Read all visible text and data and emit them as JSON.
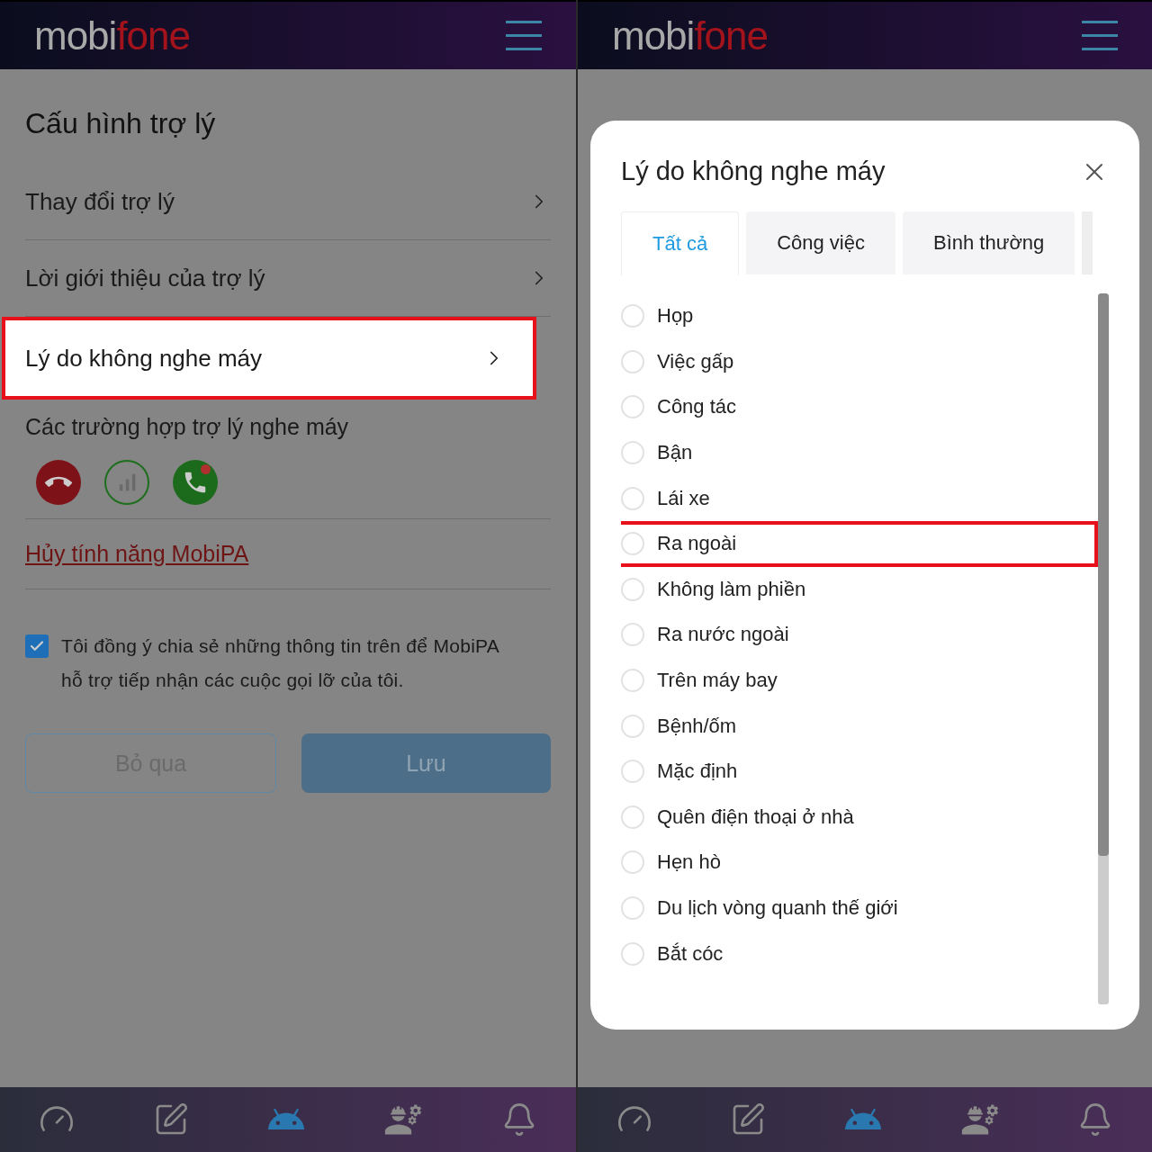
{
  "left_screen": {
    "logo": [
      "mobi",
      "fone"
    ],
    "title": "Cấu hình trợ lý",
    "menu": [
      {
        "label": "Thay đổi trợ lý",
        "highlighted": false
      },
      {
        "label": "Lời giới thiệu của trợ lý",
        "highlighted": false
      },
      {
        "label": "Lý do không nghe máy",
        "highlighted": true
      }
    ],
    "cases_label": "Các trường hợp trợ lý nghe máy",
    "cancel_link": "Hủy tính năng MobiPA",
    "consent": {
      "text": "Tôi đồng ý chia sẻ những thông tin trên để MobiPA hỗ trợ tiếp nhận các cuộc gọi lỡ của tôi.",
      "checked": true
    },
    "buttons": [
      {
        "label": "Bỏ qua",
        "kind": "outline"
      },
      {
        "label": "Lưu",
        "kind": "primary"
      }
    ],
    "nav": [
      {
        "kind": "gauge",
        "selected": false
      },
      {
        "kind": "edit",
        "selected": false
      },
      {
        "kind": "android",
        "selected": true
      },
      {
        "kind": "engineer",
        "selected": false
      },
      {
        "kind": "bell",
        "selected": false
      }
    ]
  },
  "right_screen": {
    "logo": [
      "mobi",
      "fone"
    ],
    "modal": {
      "title": "Lý do không nghe máy",
      "tabs": [
        {
          "label": "Tất cả",
          "selected": true
        },
        {
          "label": "Công việc",
          "selected": false
        },
        {
          "label": "Bình thường",
          "selected": false
        }
      ],
      "reasons": [
        {
          "label": "Họp",
          "selected": false,
          "highlighted": false
        },
        {
          "label": "Việc gấp",
          "selected": false,
          "highlighted": false
        },
        {
          "label": "Công tác",
          "selected": false,
          "highlighted": false
        },
        {
          "label": "Bận",
          "selected": false,
          "highlighted": false
        },
        {
          "label": "Lái xe",
          "selected": false,
          "highlighted": false
        },
        {
          "label": "Ra ngoài",
          "selected": false,
          "highlighted": true
        },
        {
          "label": "Không làm phiền",
          "selected": false,
          "highlighted": false
        },
        {
          "label": "Ra nước ngoài",
          "selected": false,
          "highlighted": false
        },
        {
          "label": "Trên máy bay",
          "selected": false,
          "highlighted": false
        },
        {
          "label": "Bệnh/ốm",
          "selected": false,
          "highlighted": false
        },
        {
          "label": "Mặc định",
          "selected": false,
          "highlighted": false
        },
        {
          "label": "Quên điện thoại ở nhà",
          "selected": false,
          "highlighted": false
        },
        {
          "label": "Hẹn hò",
          "selected": false,
          "highlighted": false
        },
        {
          "label": "Du lịch vòng quanh thế giới",
          "selected": false,
          "highlighted": false
        },
        {
          "label": "Bắt cóc",
          "selected": false,
          "highlighted": false
        }
      ]
    },
    "nav": [
      {
        "kind": "gauge",
        "selected": false
      },
      {
        "kind": "edit",
        "selected": false
      },
      {
        "kind": "android",
        "selected": true
      },
      {
        "kind": "engineer",
        "selected": false
      },
      {
        "kind": "bell",
        "selected": false
      }
    ]
  }
}
